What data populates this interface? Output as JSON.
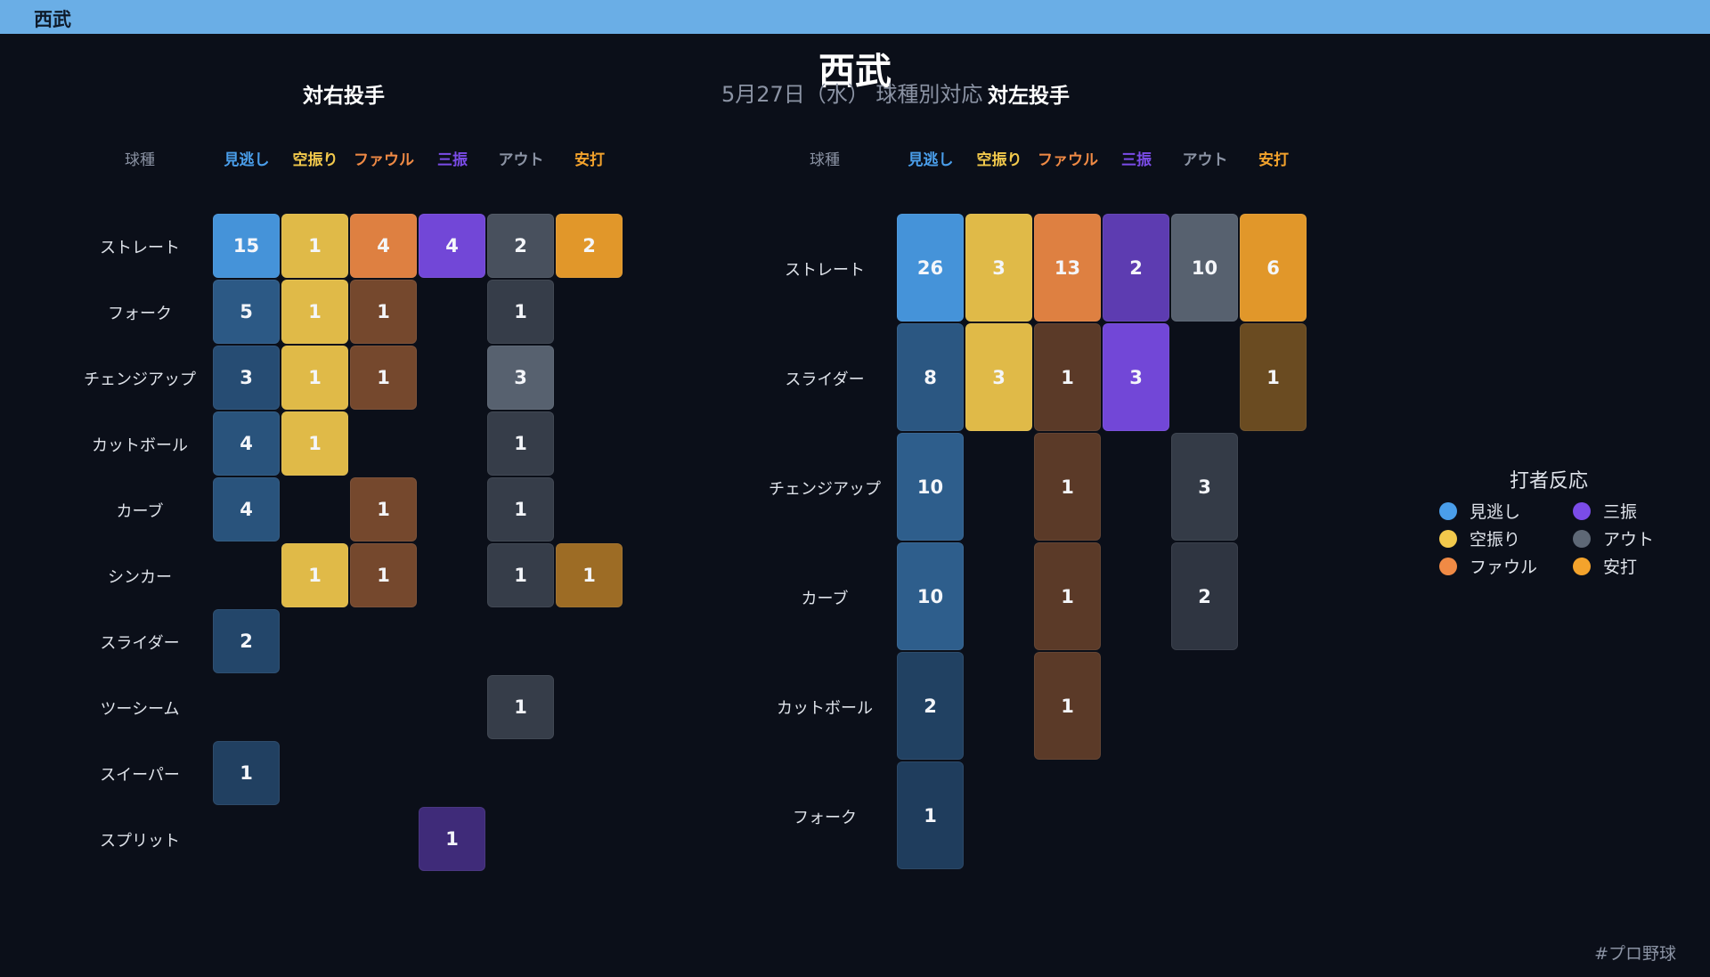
{
  "topbar": {
    "title": "西武"
  },
  "header": {
    "title": "西武",
    "subtitle": "5月27日（水） 球種別対応"
  },
  "legend": {
    "title": "打者反応"
  },
  "footer": {
    "hashtag": "#プロ野球"
  },
  "categories": [
    {
      "key": "見逃し",
      "color": "#4a9eea"
    },
    {
      "key": "空振り",
      "color": "#f2c94c"
    },
    {
      "key": "ファウル",
      "color": "#f08a45"
    },
    {
      "key": "三振",
      "color": "#7b4ce8"
    },
    {
      "key": "アウト",
      "color": "#5e6876"
    },
    {
      "key": "安打",
      "color": "#f4a32c"
    }
  ],
  "chart_data": [
    {
      "type": "heatmap",
      "title": "対右投手",
      "row_header": "球種",
      "columns": [
        "見逃し",
        "空振り",
        "ファウル",
        "三振",
        "アウト",
        "安打"
      ],
      "rows": [
        "ストレート",
        "フォーク",
        "チェンジアップ",
        "カットボール",
        "カーブ",
        "シンカー",
        "スライダー",
        "ツーシーム",
        "スイーパー",
        "スプリット"
      ],
      "values": [
        [
          15,
          1,
          4,
          4,
          2,
          2
        ],
        [
          5,
          1,
          1,
          0,
          1,
          0
        ],
        [
          3,
          1,
          1,
          0,
          3,
          0
        ],
        [
          4,
          1,
          0,
          0,
          1,
          0
        ],
        [
          4,
          0,
          1,
          0,
          1,
          0
        ],
        [
          0,
          1,
          1,
          0,
          1,
          1
        ],
        [
          2,
          0,
          0,
          0,
          0,
          0
        ],
        [
          0,
          0,
          0,
          0,
          1,
          0
        ],
        [
          1,
          0,
          0,
          0,
          0,
          0
        ],
        [
          0,
          0,
          0,
          1,
          0,
          0
        ]
      ]
    },
    {
      "type": "heatmap",
      "title": "対左投手",
      "row_header": "球種",
      "columns": [
        "見逃し",
        "空振り",
        "ファウル",
        "三振",
        "アウト",
        "安打"
      ],
      "rows": [
        "ストレート",
        "スライダー",
        "チェンジアップ",
        "カーブ",
        "カットボール",
        "フォーク"
      ],
      "values": [
        [
          26,
          3,
          13,
          2,
          10,
          6
        ],
        [
          8,
          3,
          1,
          3,
          0,
          1
        ],
        [
          10,
          0,
          1,
          0,
          3,
          0
        ],
        [
          10,
          0,
          1,
          0,
          2,
          0
        ],
        [
          2,
          0,
          1,
          0,
          0,
          0
        ],
        [
          1,
          0,
          0,
          0,
          0,
          0
        ]
      ]
    }
  ]
}
